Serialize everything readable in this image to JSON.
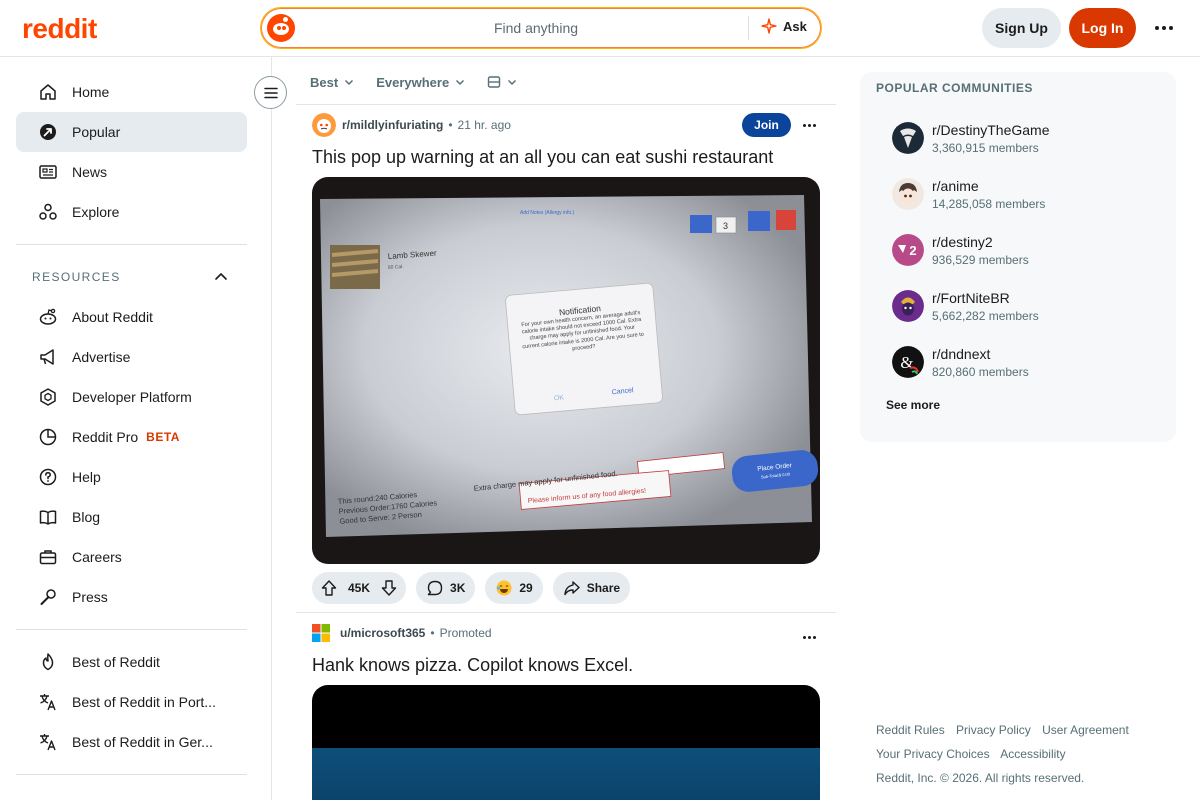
{
  "header": {
    "logo": "reddit",
    "search_placeholder": "Find anything",
    "ask_label": "Ask",
    "signup_label": "Sign Up",
    "login_label": "Log In"
  },
  "sidebar": {
    "main_items": [
      {
        "label": "Home",
        "icon": "home-icon"
      },
      {
        "label": "Popular",
        "icon": "popular-icon"
      },
      {
        "label": "News",
        "icon": "news-icon"
      },
      {
        "label": "Explore",
        "icon": "explore-icon"
      }
    ],
    "resources_header": "RESOURCES",
    "resource_items": [
      {
        "label": "About Reddit",
        "icon": "reddit-alien-icon"
      },
      {
        "label": "Advertise",
        "icon": "megaphone-icon"
      },
      {
        "label": "Developer Platform",
        "icon": "hexagon-icon"
      },
      {
        "label": "Reddit Pro",
        "icon": "pro-icon",
        "badge": "BETA"
      },
      {
        "label": "Help",
        "icon": "help-icon"
      },
      {
        "label": "Blog",
        "icon": "book-icon"
      },
      {
        "label": "Careers",
        "icon": "briefcase-icon"
      },
      {
        "label": "Press",
        "icon": "microphone-icon"
      }
    ],
    "best_items": [
      {
        "label": "Best of Reddit",
        "icon": "flame-icon"
      },
      {
        "label": "Best of Reddit in Port...",
        "icon": "translate-icon"
      },
      {
        "label": "Best of Reddit in Ger...",
        "icon": "translate-icon"
      }
    ]
  },
  "feed": {
    "sort": "Best",
    "location": "Everywhere",
    "posts": [
      {
        "subreddit": "r/mildlyinfuriating",
        "time": "21 hr. ago",
        "join_label": "Join",
        "title": "This pop up warning at an all you can eat sushi restaurant",
        "image": {
          "notes_label": "Add Notes (Allergy info.)",
          "item_name": "Lamb Skewer",
          "item_cal": "80 Cal.",
          "qty": "3",
          "notification_title": "Notification",
          "notification_body": "For your own health concern, an average adult's calorie intake should not exceed 1000 Cal. Extra charge may apply for unfinished food. Your current calorie intake is 2000 Cal. Are you sure to proceed?",
          "ok_label": "OK",
          "cancel_label": "Cancel",
          "extra_charge": "Extra charge may apply for unfinished food.",
          "allergy_label": "Please inform us of any food allergies!",
          "this_round": "This round:240 Calories",
          "previous_order": "Previous Order:1760 Calories",
          "good_to_serve": "Good to Serve: 2 Person",
          "place_order": "Place Order",
          "sub_total": "Sub-Total:$ 0.00"
        },
        "votes": "45K",
        "comments": "3K",
        "awards": "29",
        "share_label": "Share"
      },
      {
        "subreddit": "u/microsoft365",
        "time": "Promoted",
        "title": "Hank knows pizza. Copilot knows Excel."
      }
    ]
  },
  "right": {
    "header": "POPULAR COMMUNITIES",
    "communities": [
      {
        "name": "r/DestinyTheGame",
        "members": "3,360,915 members",
        "color": "#1c2a38"
      },
      {
        "name": "r/anime",
        "members": "14,285,058 members",
        "color": "#f2e8e2"
      },
      {
        "name": "r/destiny2",
        "members": "936,529 members",
        "color": "#b94a8a"
      },
      {
        "name": "r/FortNiteBR",
        "members": "5,662,282 members",
        "color": "#6a2b8c"
      },
      {
        "name": "r/dndnext",
        "members": "820,860 members",
        "color": "#111111"
      }
    ],
    "destiny2_glyph": "2",
    "dnd_glyph": "&",
    "see_more": "See more"
  },
  "footer": {
    "links": [
      "Reddit Rules",
      "Privacy Policy",
      "User Agreement",
      "Your Privacy Choices",
      "Accessibility"
    ],
    "copyright": "Reddit, Inc. © 2026. All rights reserved."
  },
  "colors": {
    "brand": "#ff4500",
    "login": "#d93900",
    "join": "#0a449b"
  }
}
